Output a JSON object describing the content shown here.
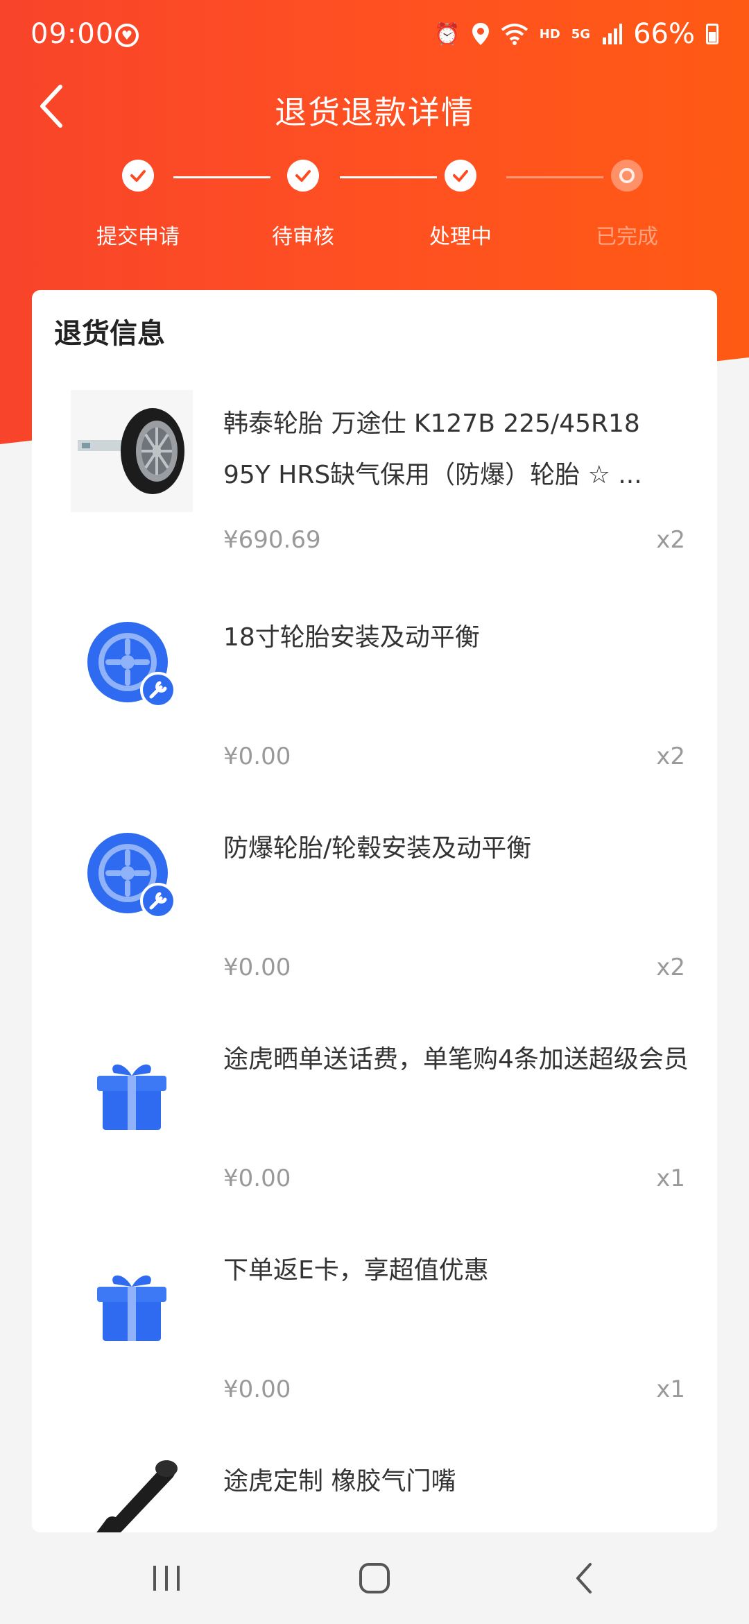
{
  "status_bar": {
    "time": "09:00",
    "battery": "66%",
    "hd": "HD",
    "net": "5G"
  },
  "nav": {
    "title": "退货退款详情"
  },
  "steps": [
    {
      "label": "提交申请",
      "done": true
    },
    {
      "label": "待审核",
      "done": true
    },
    {
      "label": "处理中",
      "done": true
    },
    {
      "label": "已完成",
      "done": false
    }
  ],
  "section": {
    "title": "退货信息"
  },
  "items": [
    {
      "name": "韩泰轮胎 万途仕 K127B 225/45R18 95Y HRS缺气保用（防爆）轮胎 ☆ ...",
      "price": "¥690.69",
      "qty": "x2",
      "icon": "tire-image"
    },
    {
      "name": "18寸轮胎安装及动平衡",
      "price": "¥0.00",
      "qty": "x2",
      "icon": "wheel-service-icon"
    },
    {
      "name": "防爆轮胎/轮毂安装及动平衡",
      "price": "¥0.00",
      "qty": "x2",
      "icon": "wheel-service-icon"
    },
    {
      "name": "途虎晒单送话费，单笔购4条加送超级会员",
      "price": "¥0.00",
      "qty": "x1",
      "icon": "gift-icon"
    },
    {
      "name": "下单返E卡，享超值优惠",
      "price": "¥0.00",
      "qty": "x1",
      "icon": "gift-icon"
    },
    {
      "name": "途虎定制 橡胶气门嘴",
      "price": "",
      "qty": "",
      "icon": "valve-image"
    }
  ],
  "colors": {
    "brand": "#ff4a1f",
    "service_blue": "#2f6bf0"
  }
}
